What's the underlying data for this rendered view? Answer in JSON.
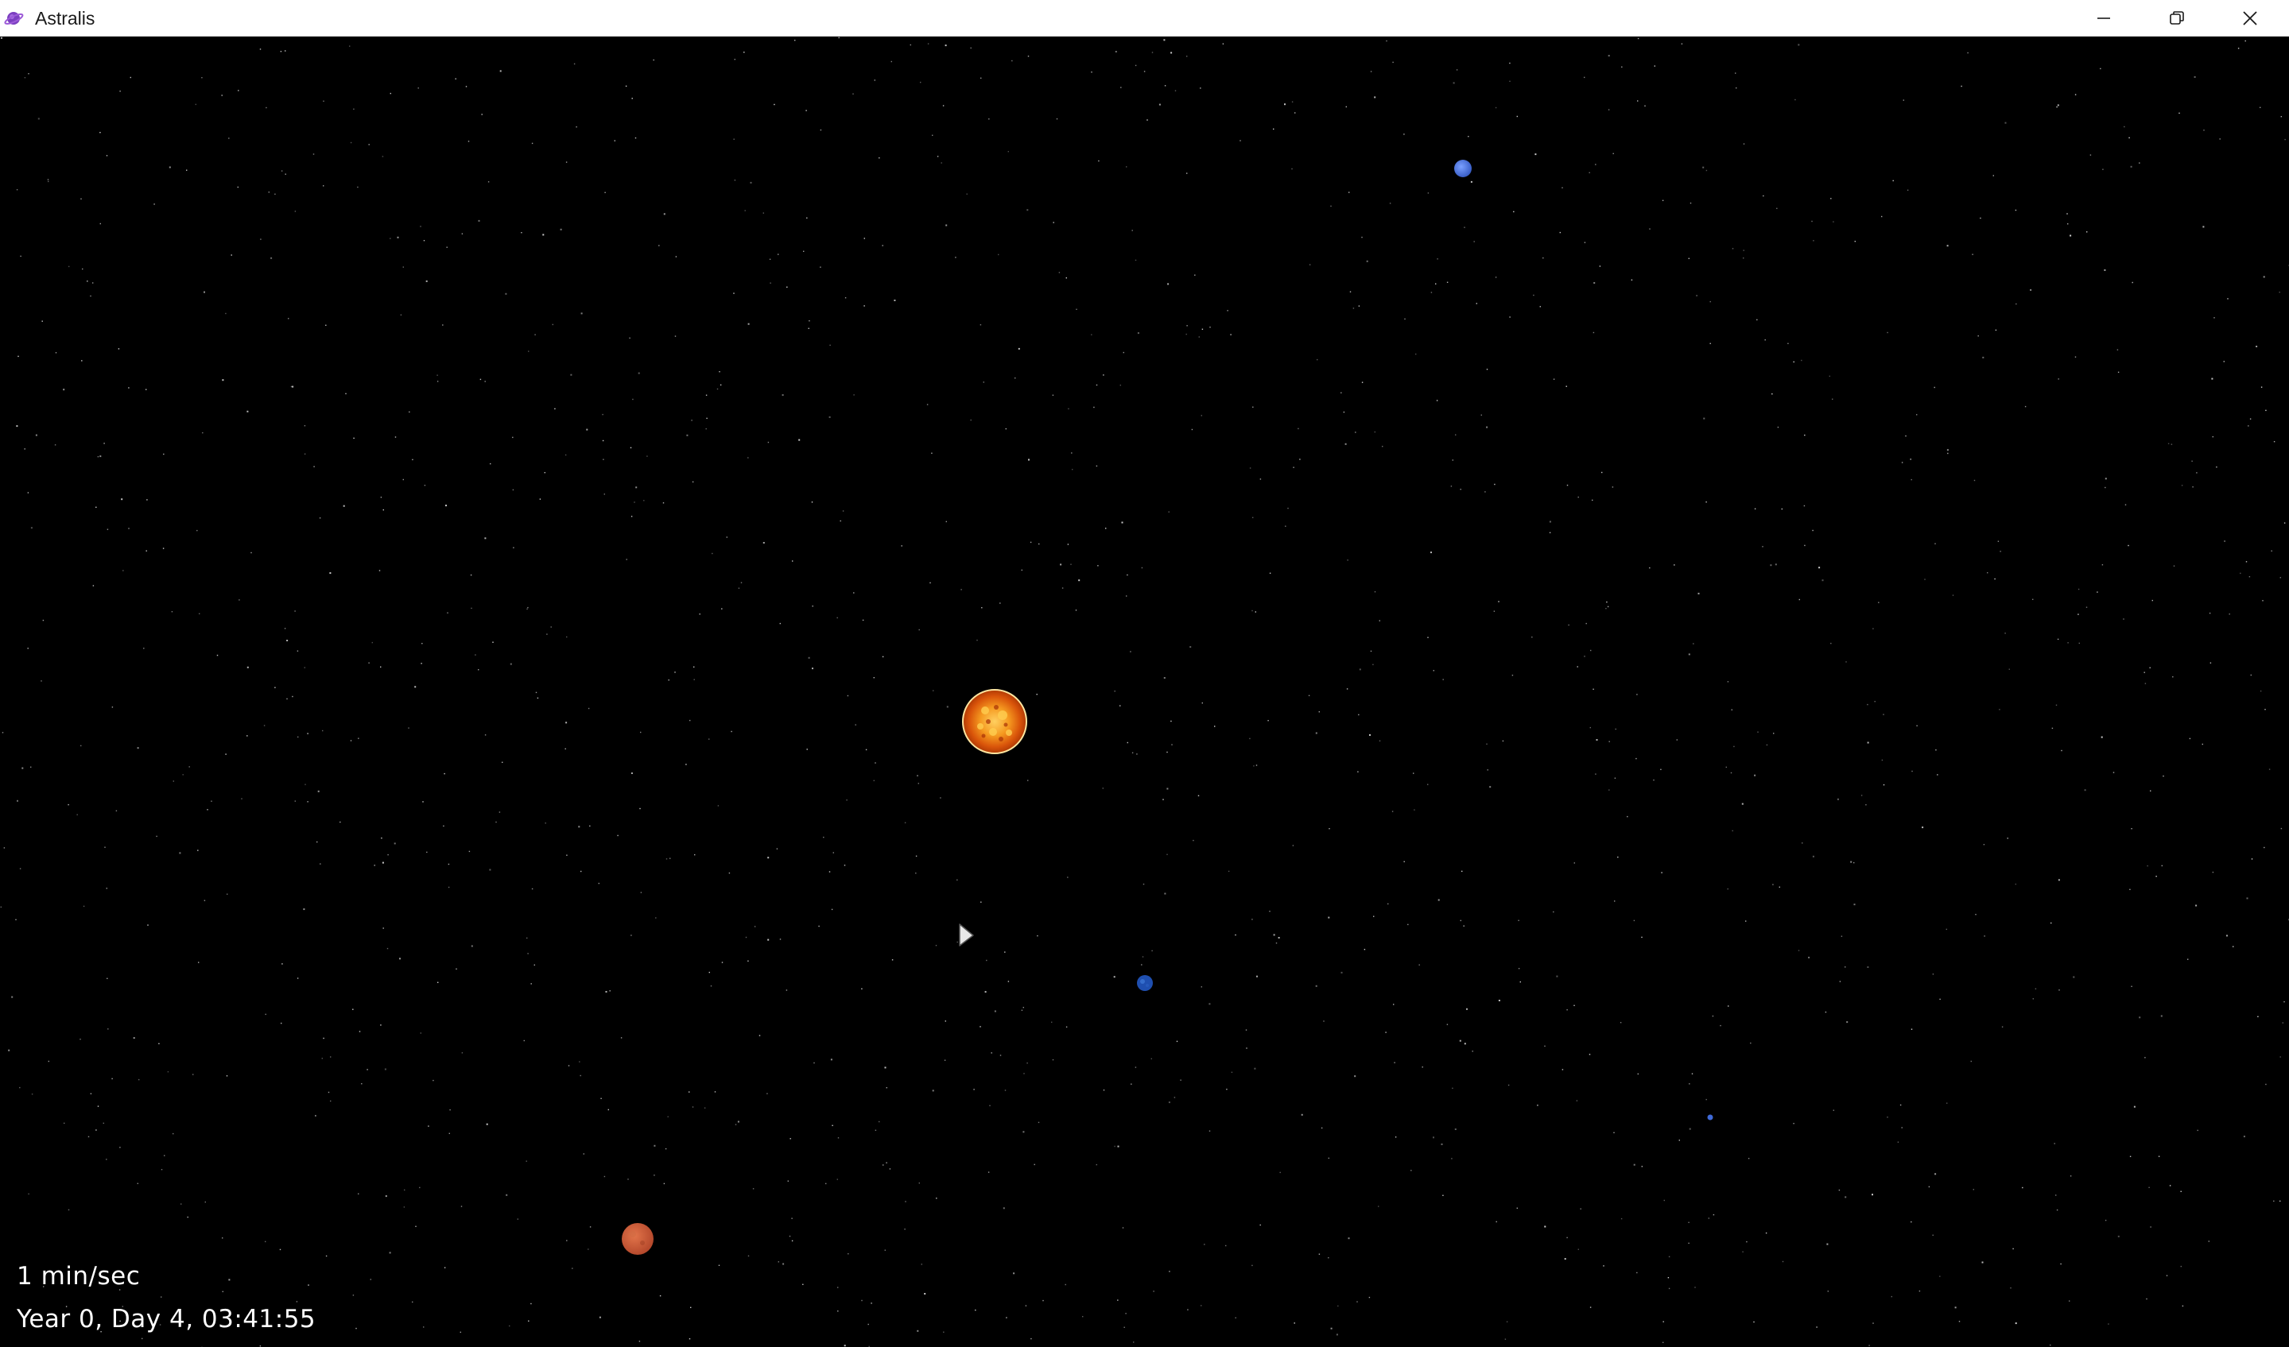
{
  "window": {
    "title": "Astralis",
    "icons": {
      "app": "planet-icon",
      "minimize": "minimize-icon",
      "maximize": "restore-icon",
      "close": "close-icon"
    }
  },
  "hud": {
    "time_rate": "1 min/sec",
    "sim_date": "Year 0, Day 4, 03:41:55"
  },
  "bodies": [
    {
      "name": "sun",
      "color": "#f07a10"
    },
    {
      "name": "blue-planet",
      "color": "#4a74e0"
    },
    {
      "name": "earth",
      "color": "#1f4fb0"
    },
    {
      "name": "small-planet",
      "color": "#3f6ad8"
    },
    {
      "name": "mars",
      "color": "#c2522e"
    }
  ],
  "colors": {
    "background": "#000000",
    "titlebar": "#ffffff",
    "star": "#d8d8d8"
  }
}
